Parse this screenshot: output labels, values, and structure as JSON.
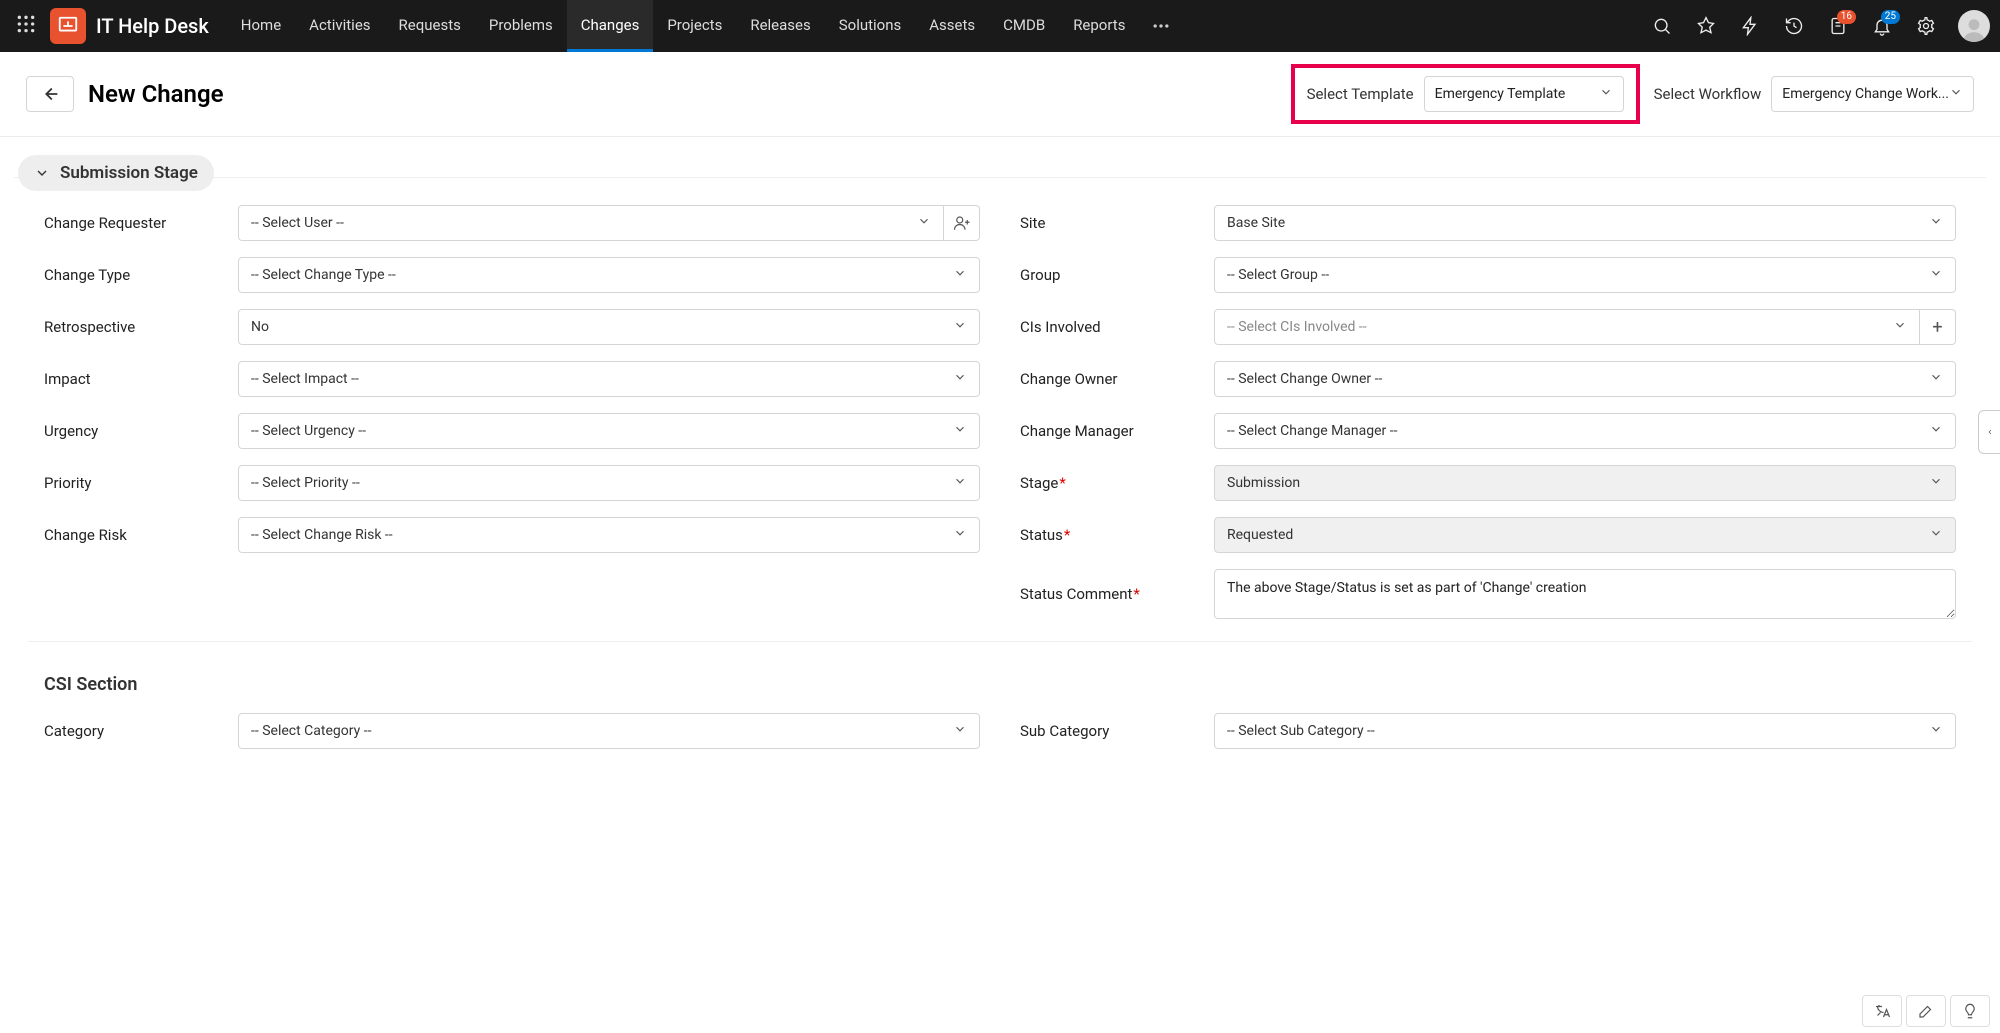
{
  "brand": "IT Help Desk",
  "nav": {
    "tabs": [
      "Home",
      "Activities",
      "Requests",
      "Problems",
      "Changes",
      "Projects",
      "Releases",
      "Solutions",
      "Assets",
      "CMDB",
      "Reports"
    ],
    "active": "Changes",
    "badges": {
      "pending": "16",
      "notifications": "25"
    }
  },
  "page": {
    "title": "New Change",
    "template_label": "Select Template",
    "template_value": "Emergency Template",
    "workflow_label": "Select Workflow",
    "workflow_value": "Emergency Change Work..."
  },
  "stage_chip": "Submission Stage",
  "left_fields": [
    {
      "label": "Change Requester",
      "value": "-- Select User --",
      "kind": "select-user"
    },
    {
      "label": "Change Type",
      "value": "-- Select Change Type --",
      "kind": "select"
    },
    {
      "label": "Retrospective",
      "value": "No",
      "kind": "select"
    },
    {
      "label": "Impact",
      "value": "-- Select Impact --",
      "kind": "select"
    },
    {
      "label": "Urgency",
      "value": "-- Select Urgency --",
      "kind": "select"
    },
    {
      "label": "Priority",
      "value": "-- Select Priority --",
      "kind": "select"
    },
    {
      "label": "Change Risk",
      "value": "-- Select Change Risk --",
      "kind": "select"
    }
  ],
  "right_fields": [
    {
      "label": "Site",
      "value": "Base Site",
      "kind": "select"
    },
    {
      "label": "Group",
      "value": "-- Select Group --",
      "kind": "select"
    },
    {
      "label": "CIs Involved",
      "value": "-- Select CIs Involved --",
      "kind": "select-plus",
      "light": true
    },
    {
      "label": "Change Owner",
      "value": "-- Select Change Owner --",
      "kind": "select"
    },
    {
      "label": "Change Manager",
      "value": "-- Select Change Manager --",
      "kind": "select"
    },
    {
      "label": "Stage",
      "required": true,
      "value": "Submission",
      "kind": "readonly"
    },
    {
      "label": "Status",
      "required": true,
      "value": "Requested",
      "kind": "readonly"
    },
    {
      "label": "Status Comment",
      "required": true,
      "value": "The above Stage/Status is set as part of 'Change' creation",
      "kind": "textarea"
    }
  ],
  "csi": {
    "title": "CSI Section",
    "left": [
      {
        "label": "Category",
        "value": "-- Select Category --",
        "kind": "select"
      }
    ],
    "right": [
      {
        "label": "Sub Category",
        "value": "-- Select Sub Category --",
        "kind": "select"
      }
    ]
  }
}
